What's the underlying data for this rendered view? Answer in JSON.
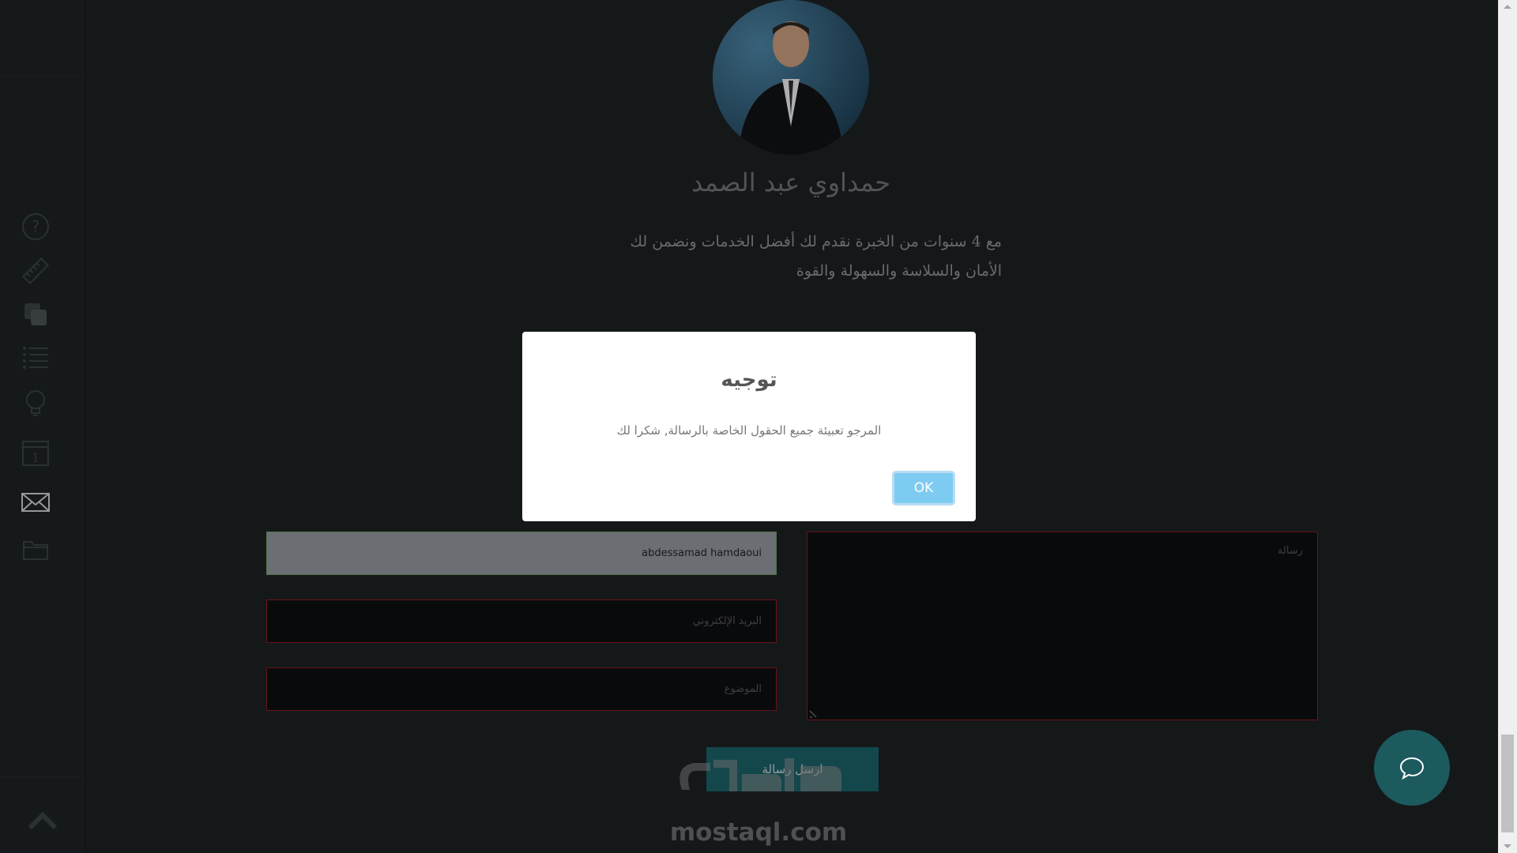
{
  "profile": {
    "name": "حمداوي عبد الصمد",
    "bio_line1": "مع 4 سنوات من الخبرة نقدم لك أفضل الخدمات ونضمن لك",
    "bio_line2": "الأمان والسلاسة والسهولة والقوة"
  },
  "sidebar": {
    "icons": [
      "help-icon",
      "ruler-icon",
      "layers-icon",
      "list-icon",
      "lightbulb-icon",
      "calendar-icon",
      "envelope-icon",
      "folder-icon"
    ],
    "calendar_day": "1"
  },
  "form": {
    "name_value": "abdessamad hamdaoui",
    "email_placeholder": "البريد الإلكتروني",
    "subject_placeholder": "الموضوع",
    "message_placeholder": "رسالة",
    "send_label": "ارسل رسالة"
  },
  "modal": {
    "title": "توجيه",
    "text": "المرجو تعبيئة جميع الحقول الخاصة بالرسالة, شكرا لك",
    "ok_label": "OK"
  },
  "watermark": {
    "logo_text": "مستقل",
    "site": "mostaql.com"
  },
  "colors": {
    "background": "#1c2022",
    "accent": "#1a5f66",
    "ok_button": "#7ecbf1",
    "field_error_border": "#8a1a1f"
  }
}
